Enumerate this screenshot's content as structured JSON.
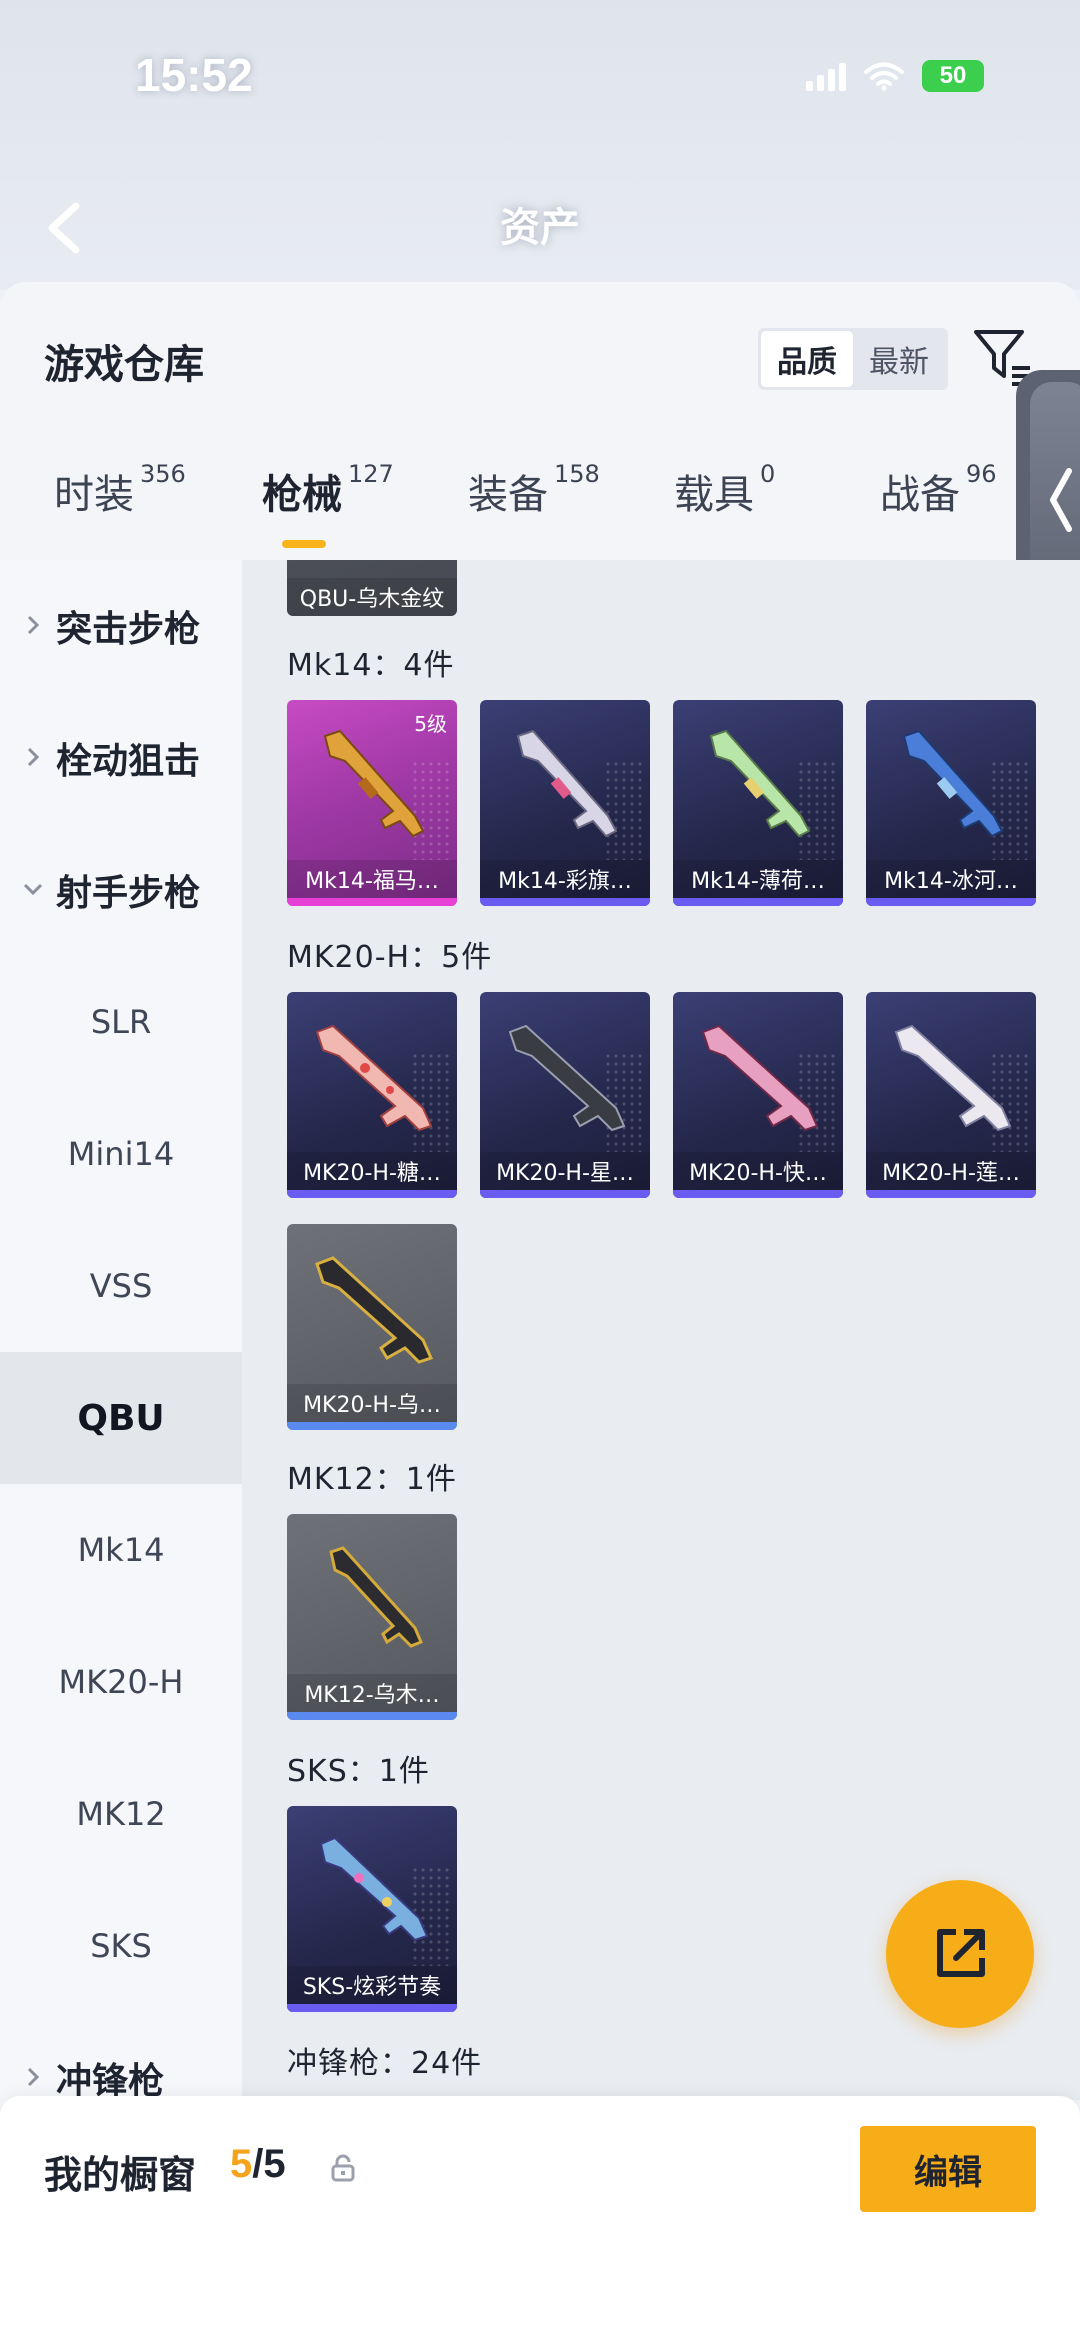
{
  "status_bar": {
    "time": "15:52",
    "battery": "50"
  },
  "nav": {
    "title": "资产",
    "left_blur": "",
    "right_blur": ""
  },
  "card": {
    "title": "游戏仓库",
    "sort_options": [
      "品质",
      "最新"
    ],
    "sort_selected": "品质"
  },
  "tabs": [
    {
      "label": "时装",
      "count": "356"
    },
    {
      "label": "枪械",
      "count": "127"
    },
    {
      "label": "装备",
      "count": "158"
    },
    {
      "label": "载具",
      "count": "0"
    },
    {
      "label": "战备",
      "count": "96"
    }
  ],
  "active_tab": "枪械",
  "sidebar": {
    "items": [
      {
        "label": "突击步枪",
        "type": "category",
        "expanded": false
      },
      {
        "label": "栓动狙击",
        "type": "category",
        "expanded": false
      },
      {
        "label": "射手步枪",
        "type": "category",
        "expanded": true
      },
      {
        "label": "SLR",
        "type": "sub"
      },
      {
        "label": "Mini14",
        "type": "sub"
      },
      {
        "label": "VSS",
        "type": "sub"
      },
      {
        "label": "QBU",
        "type": "sub",
        "active": true
      },
      {
        "label": "Mk14",
        "type": "sub"
      },
      {
        "label": "MK20-H",
        "type": "sub"
      },
      {
        "label": "MK12",
        "type": "sub"
      },
      {
        "label": "SKS",
        "type": "sub"
      },
      {
        "label": "冲锋枪",
        "type": "category",
        "expanded": false
      }
    ]
  },
  "content": {
    "top_partial": "QBU-乌木金纹",
    "groups": [
      {
        "title": "Mk14：4件",
        "items": [
          {
            "name": "Mk14-福马…",
            "rarity": "pink",
            "badge": "5级"
          },
          {
            "name": "Mk14-彩旗…",
            "rarity": "purple",
            "badge": ""
          },
          {
            "name": "Mk14-薄荷…",
            "rarity": "purple",
            "badge": ""
          },
          {
            "name": "Mk14-冰河…",
            "rarity": "purple",
            "badge": ""
          }
        ]
      },
      {
        "title": "MK20-H：5件",
        "items": [
          {
            "name": "MK20-H-糖…",
            "rarity": "purple",
            "badge": ""
          },
          {
            "name": "MK20-H-星…",
            "rarity": "purple",
            "badge": ""
          },
          {
            "name": "MK20-H-快…",
            "rarity": "purple",
            "badge": ""
          },
          {
            "name": "MK20-H-莲…",
            "rarity": "purple",
            "badge": ""
          },
          {
            "name": "MK20-H-乌…",
            "rarity": "gray",
            "badge": ""
          }
        ]
      },
      {
        "title": "MK12：1件",
        "items": [
          {
            "name": "MK12-乌木…",
            "rarity": "gray",
            "badge": ""
          }
        ]
      },
      {
        "title": "SKS：1件",
        "items": [
          {
            "name": "SKS-炫彩节奏",
            "rarity": "purple",
            "badge": ""
          }
        ]
      }
    ],
    "next_group_title": "冲锋枪：24件"
  },
  "bottom": {
    "window_label": "我的橱窗",
    "used": "5",
    "total": "/5",
    "edit_label": "编辑"
  },
  "colors": {
    "accent": "#f6ad17",
    "purple_tile": "#2a2d55",
    "pink_tile": "#b843b6",
    "gray_tile": "#5f6269"
  },
  "icons": [
    "back-icon",
    "filter-icon",
    "chevron-right-icon",
    "chevron-down-icon",
    "share-icon",
    "lock-icon",
    "wifi-icon",
    "signal-icon"
  ]
}
